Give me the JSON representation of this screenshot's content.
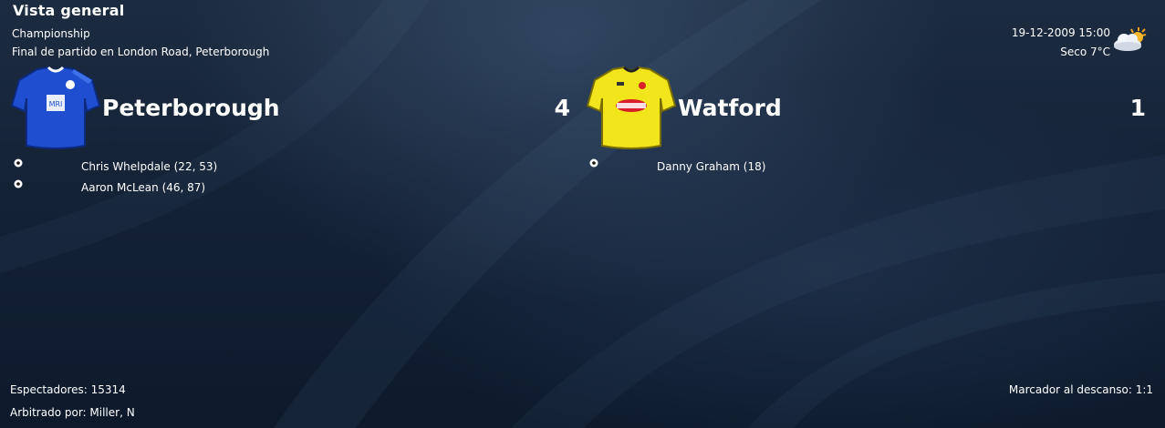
{
  "header": {
    "title": "Vista general",
    "competition": "Championship",
    "venue": "Final de partido en London Road, Peterborough",
    "datetime": "19-12-2009 15:00",
    "weather": "Seco 7°C",
    "weather_icon": "partly-cloudy-icon"
  },
  "home": {
    "name": "Peterborough",
    "score": "4",
    "shirt_color": "#1f4fd0",
    "scorers": [
      {
        "text": "Chris Whelpdale (22, 53)"
      },
      {
        "text": "Aaron McLean (46, 87)"
      }
    ]
  },
  "away": {
    "name": "Watford",
    "score": "1",
    "shirt_color": "#f2e51c",
    "scorers": [
      {
        "text": "Danny Graham (18)"
      }
    ]
  },
  "footer": {
    "attendance": "Espectadores: 15314",
    "referee": "Arbitrado por: Miller, N",
    "halftime": "Marcador al descanso: 1:1"
  },
  "colors": {
    "background": "#142236",
    "text": "#ffffff"
  }
}
